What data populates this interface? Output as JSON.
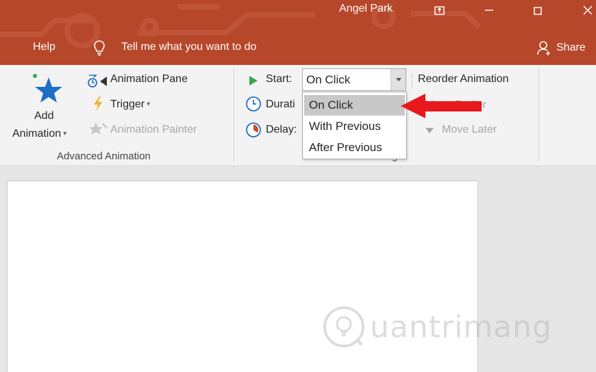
{
  "title_bar": {
    "user_name": "Angel Park",
    "menu": {
      "help": "Help",
      "tell_me": "Tell me what you want to do"
    },
    "share": "Share",
    "accent_color": "#b7472a"
  },
  "ribbon": {
    "advanced_animation": {
      "add_animation_line1": "Add",
      "add_animation_line2": "Animation",
      "animation_pane": "Animation Pane",
      "trigger": "Trigger",
      "animation_painter": "Animation Painter",
      "group_label": "Advanced Animation"
    },
    "timing": {
      "start_label": "Start:",
      "start_value": "On Click",
      "duration_label": "Durati",
      "delay_label": "Delay:",
      "group_label": "Timing",
      "start_options": [
        "On Click",
        "With Previous",
        "After Previous"
      ]
    },
    "reorder": {
      "reorder_animation": "Reorder Animation",
      "move_earlier": "Move Earlier",
      "move_later": "Move Later"
    }
  },
  "watermark": {
    "text": "uantrimang"
  },
  "icons": [
    "lightbulb-icon",
    "person-add-icon",
    "add-animation-star-icon",
    "animation-pane-icon",
    "trigger-lightning-icon",
    "animation-painter-icon",
    "play-triangle-icon",
    "duration-clock-icon",
    "delay-clock-icon",
    "move-later-arrow-icon",
    "restore-window-icon",
    "close-window-icon",
    "minimize-window-icon",
    "ribbon-display-icon"
  ]
}
